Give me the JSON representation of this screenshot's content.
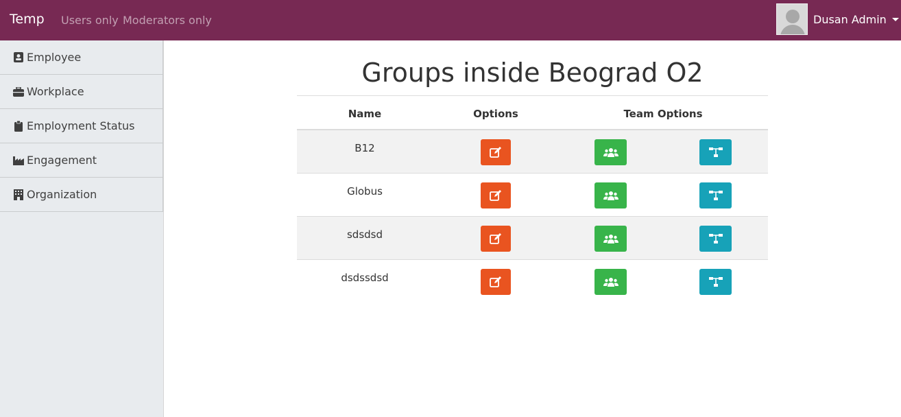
{
  "navbar": {
    "brand": "Temp",
    "links": [
      "Users only",
      "Moderators only"
    ],
    "user_name": "Dusan Admin",
    "color": "#772953"
  },
  "sidebar": {
    "items": [
      {
        "label": "Employee",
        "icon": "id-card-icon"
      },
      {
        "label": "Workplace",
        "icon": "briefcase-icon"
      },
      {
        "label": "Employment Status",
        "icon": "clipboard-icon"
      },
      {
        "label": "Engagement",
        "icon": "industry-icon"
      },
      {
        "label": "Organization",
        "icon": "building-icon"
      }
    ]
  },
  "main": {
    "title": "Groups inside Beograd O2",
    "columns": [
      "Name",
      "Options",
      "Team Options"
    ],
    "rows": [
      {
        "name": "B12"
      },
      {
        "name": "Globus"
      },
      {
        "name": "sdsdsd"
      },
      {
        "name": "dsdssdsd"
      }
    ],
    "button_icons": [
      "edit-icon",
      "users-icon",
      "sitemap-icon"
    ],
    "button_colors": {
      "edit": "#e95420",
      "team": "#38b44a",
      "org": "#17a2b8"
    }
  }
}
